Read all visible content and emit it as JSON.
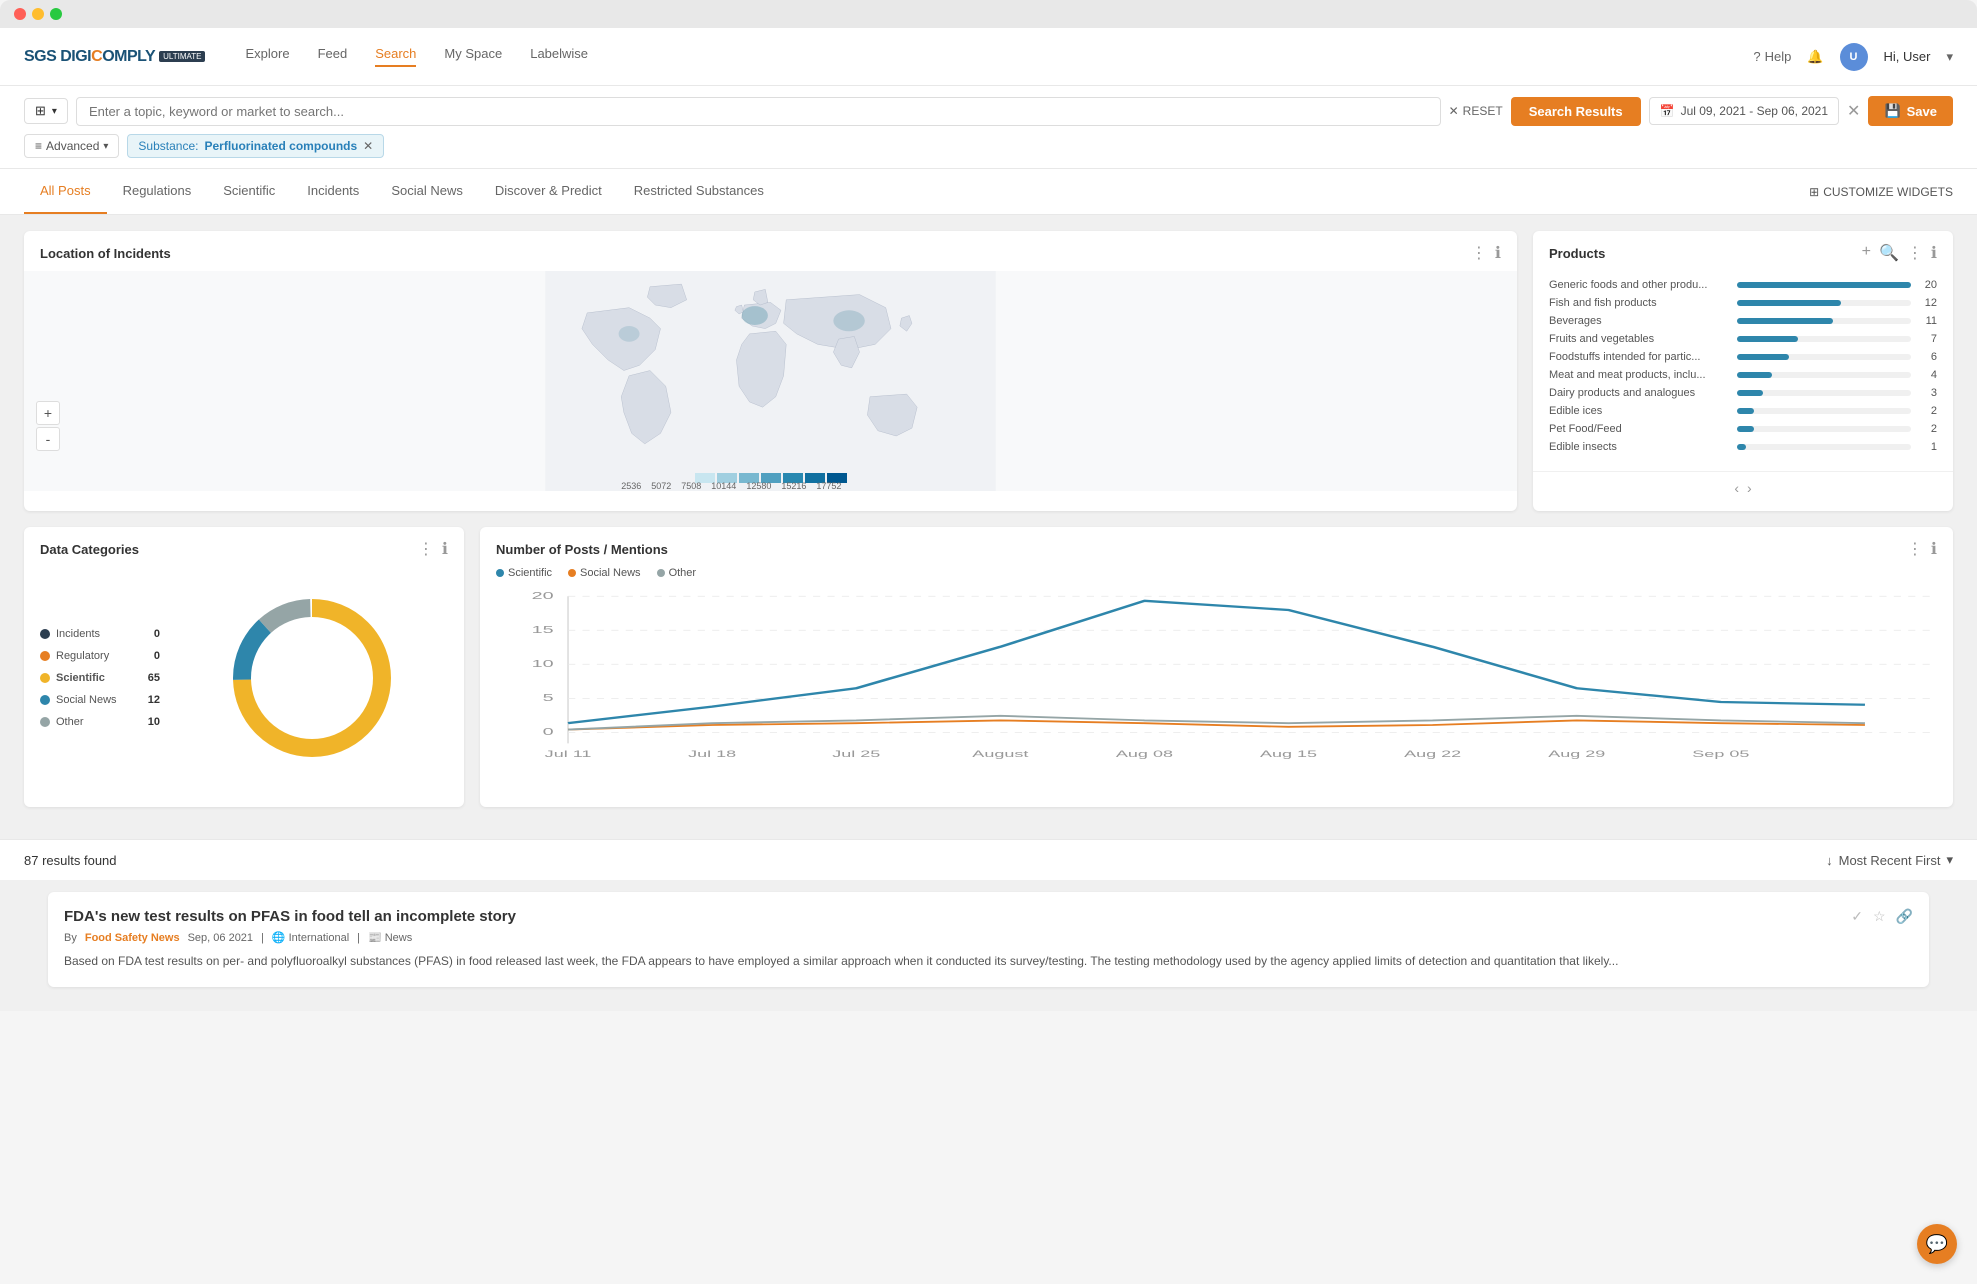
{
  "window": {
    "title": "SGS DigiComply"
  },
  "nav": {
    "logo": "SGS DIGICOMPLY",
    "badge": "ULTIMATE",
    "links": [
      "Explore",
      "Feed",
      "Search",
      "My Space",
      "Labelwise"
    ],
    "active_link": "Search",
    "help": "Help",
    "user": "Hi, User",
    "user_initials": "U"
  },
  "search": {
    "placeholder": "Enter a topic, keyword or market to search...",
    "reset": "RESET",
    "search_results": "Search Results",
    "date_range": "Jul 09, 2021 - Sep 06, 2021",
    "save": "Save",
    "advanced": "Advanced",
    "tag_label": "Substance:",
    "tag_value": "Perfluorinated compounds"
  },
  "tabs": {
    "items": [
      "All Posts",
      "Regulations",
      "Scientific",
      "Incidents",
      "Social News",
      "Discover & Predict",
      "Restricted Substances"
    ],
    "active": "All Posts",
    "customize": "CUSTOMIZE WIDGETS"
  },
  "map_widget": {
    "title": "Location of Incidents",
    "zoom_in": "+",
    "zoom_out": "-",
    "legend_values": [
      "2536",
      "5072",
      "7508",
      "10144",
      "12580",
      "15216",
      "17752"
    ]
  },
  "products_widget": {
    "title": "Products",
    "items": [
      {
        "name": "Generic foods and other produ...",
        "count": 20,
        "pct": 100
      },
      {
        "name": "Fish and fish products",
        "count": 12,
        "pct": 60
      },
      {
        "name": "Beverages",
        "count": 11,
        "pct": 55
      },
      {
        "name": "Fruits and vegetables",
        "count": 7,
        "pct": 35
      },
      {
        "name": "Foodstuffs intended for partic...",
        "count": 6,
        "pct": 30
      },
      {
        "name": "Meat and meat products, inclu...",
        "count": 4,
        "pct": 20
      },
      {
        "name": "Dairy products and analogues",
        "count": 3,
        "pct": 15
      },
      {
        "name": "Edible ices",
        "count": 2,
        "pct": 10
      },
      {
        "name": "Pet Food/Feed",
        "count": 2,
        "pct": 10
      },
      {
        "name": "Edible insects",
        "count": 1,
        "pct": 5
      }
    ]
  },
  "data_categories": {
    "title": "Data Categories",
    "items": [
      {
        "label": "Incidents",
        "value": 0,
        "color": "#2c3e50"
      },
      {
        "label": "Regulatory",
        "value": 0,
        "color": "#e67e22"
      },
      {
        "label": "Scientific",
        "value": 65,
        "color": "#f0b429",
        "bold": true
      },
      {
        "label": "Social News",
        "value": 12,
        "color": "#2e86ab"
      },
      {
        "label": "Other",
        "value": 10,
        "color": "#95a5a6"
      }
    ]
  },
  "mentions": {
    "title": "Number of Posts / Mentions",
    "legend": [
      {
        "label": "Scientific",
        "color": "#2e86ab"
      },
      {
        "label": "Social News",
        "color": "#e67e22"
      },
      {
        "label": "Other",
        "color": "#95a5a6"
      }
    ],
    "x_labels": [
      "Jul 11",
      "Jul 18",
      "Jul 25",
      "August",
      "Aug 08",
      "Aug 15",
      "Aug 22",
      "Aug 29",
      "Sep 05"
    ],
    "y_labels": [
      "0",
      "5",
      "10",
      "15",
      "20"
    ]
  },
  "results": {
    "count": "87 results found",
    "sort": "Most Recent First"
  },
  "result_card": {
    "title": "FDA's new test results on PFAS in food tell an incomplete story",
    "source": "Food Safety News",
    "date": "Sep, 06 2021",
    "region": "International",
    "tag": "News",
    "excerpt": "Based on FDA test results on per- and polyfluoroalkyl substances (PFAS) in food released last week, the FDA appears to have employed a similar approach when it conducted its survey/testing. The testing methodology used by the agency applied limits of detection and quantitation that likely..."
  }
}
